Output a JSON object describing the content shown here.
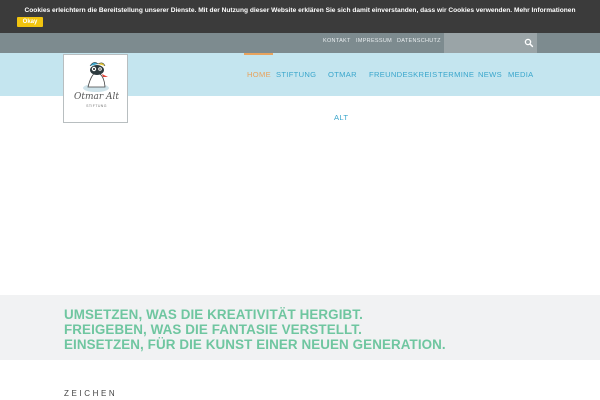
{
  "cookie": {
    "text": "Cookies erleichtern die Bereitstellung unserer Dienste. Mit der Nutzung dieser Website erklären Sie sich damit einverstanden, dass wir Cookies verwenden.",
    "more_link": "Mehr Informationen",
    "ok_button": "Okay"
  },
  "topbar": {
    "links": [
      "KONTAKT",
      "IMPRESSUM",
      "DATENSCHUTZ"
    ],
    "search_icon": "search-icon"
  },
  "logo": {
    "name": "Otmar Alt",
    "sub": "STIFTUNG"
  },
  "nav": {
    "items": [
      "HOME",
      "STIFTUNG",
      "OTMAR",
      "ALT",
      "FREUNDESKREIS",
      "TERMINE",
      "NEWS",
      "MEDIA"
    ],
    "active_color": "#e8a35d",
    "link_color": "#3aa6cc"
  },
  "slogan": {
    "lines": [
      "UMSETZEN, WAS DIE KREATIVITÄT HERGIBT.",
      "FREIGEBEN, WAS DIE FANTASIE VERSTELLT.",
      "EINSETZEN, FÜR DIE KUNST EINER NEUEN GENERATION."
    ],
    "color": "#6fc6a0"
  },
  "section": {
    "label": "ZEICHEN"
  }
}
